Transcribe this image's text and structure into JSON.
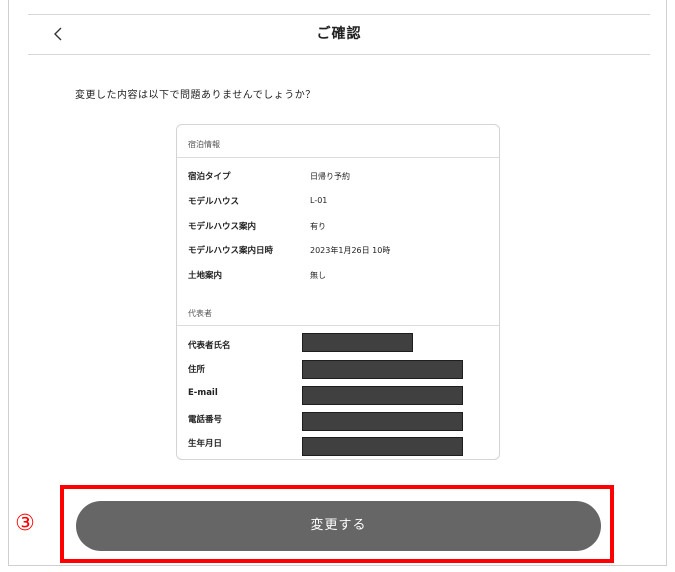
{
  "header": {
    "title": "ご確認",
    "back_icon": "chevron-left-icon"
  },
  "question": "変更した内容は以下で問題ありませんでしょうか？",
  "stay_section": {
    "label": "宿泊情報",
    "rows": [
      {
        "label": "宿泊タイプ",
        "value": "日帰り予約"
      },
      {
        "label": "モデルハウス",
        "value": "L-01"
      },
      {
        "label": "モデルハウス案内",
        "value": "有り"
      },
      {
        "label": "モデルハウス案内日時",
        "value": "2023年1月26日 10時"
      },
      {
        "label": "土地案内",
        "value": "無し"
      }
    ]
  },
  "representative_section": {
    "label": "代表者",
    "rows": [
      {
        "label": "代表者氏名"
      },
      {
        "label": "住所"
      },
      {
        "label": "E-mail"
      },
      {
        "label": "電話番号"
      },
      {
        "label": "生年月日"
      }
    ]
  },
  "annotation": {
    "step_marker": "③",
    "highlight_color": "#ff0000"
  },
  "submit_button": {
    "label": "変更する",
    "color": "#666666"
  }
}
